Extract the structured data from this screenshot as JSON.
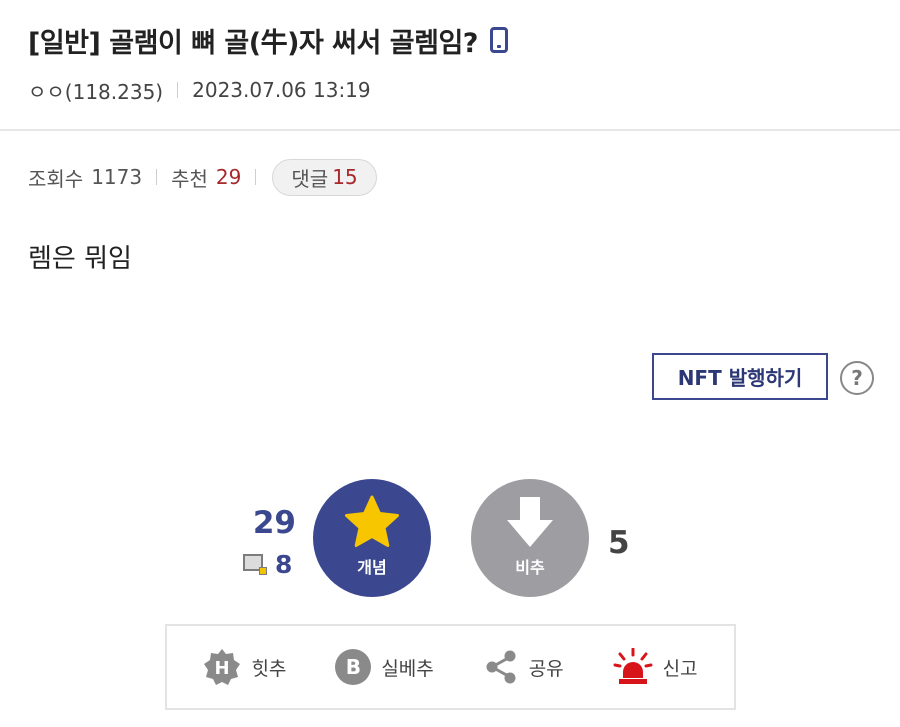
{
  "post": {
    "title": "[일반] 골램이 뼈 골(牛)자 써서 골렘임?",
    "device_icon": "mobile-phone-icon",
    "author": "ㅇㅇ(118.235)",
    "datetime": "2023.07.06 13:19",
    "views_label": "조회수",
    "views": "1173",
    "recommend_label": "추천",
    "recommend": "29",
    "comments_label": "댓글",
    "comments": "15",
    "body": "렘은 뭐임"
  },
  "nft": {
    "button_label": "NFT 발행하기",
    "help_label": "?"
  },
  "vote": {
    "up_count": "29",
    "fixed_count": "8",
    "up_label": "개념",
    "down_label": "비추",
    "down_count": "5"
  },
  "actions": {
    "hit_label": "힛추",
    "hit_icon_letter": "H",
    "best_label": "실베추",
    "best_icon_letter": "B",
    "share_label": "공유",
    "report_label": "신고"
  },
  "colors": {
    "accent": "#3b4890",
    "count_red": "#a8282c",
    "report_red": "#d7141a",
    "icon_gray": "#8a8a8a",
    "star": "#f7c600"
  }
}
